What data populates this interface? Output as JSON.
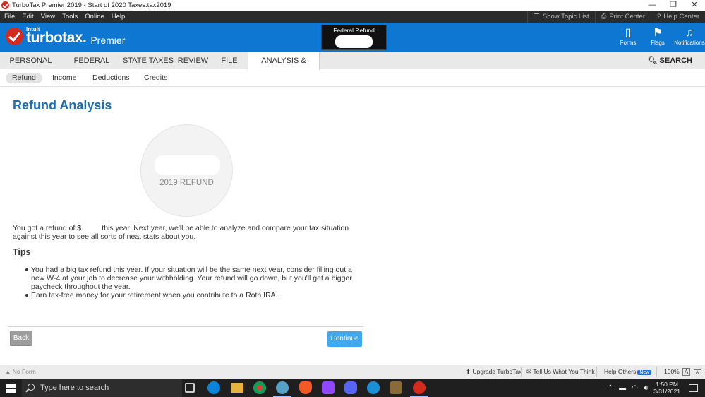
{
  "window": {
    "title": "TurboTax Premier 2019 - Start of 2020 Taxes.tax2019",
    "controls": [
      "—",
      "❐",
      "✕"
    ]
  },
  "menu": {
    "items": [
      "File",
      "Edit",
      "View",
      "Tools",
      "Online",
      "Help"
    ],
    "right": [
      "Show Topic List",
      "Print Center",
      "Help Center"
    ]
  },
  "header": {
    "logo_intuit": "intuit",
    "logo_brand": "turbotax.",
    "logo_edition": "Premier",
    "refund_label": "Federal Refund",
    "icons": [
      {
        "label": "Forms",
        "glyph": "🗋"
      },
      {
        "label": "Flags",
        "glyph": "⚑"
      },
      {
        "label": "Notifications",
        "glyph": "🔔"
      }
    ],
    "brand_color": "#0e77d1"
  },
  "nav": {
    "tabs": [
      "PERSONAL INFO",
      "FEDERAL TAXES",
      "STATE TAXES",
      "REVIEW",
      "FILE",
      "ANALYSIS & ADVICE"
    ],
    "active_tab": "ANALYSIS & ADVICE",
    "search_label": "SEARCH"
  },
  "subtabs": {
    "items": [
      "Refund",
      "Income",
      "Deductions",
      "Credits"
    ],
    "active": "Refund"
  },
  "main": {
    "title": "Refund Analysis",
    "circle_caption": "2019 REFUND",
    "summary": "You got a refund of $          this year. Next year, we'll be able to analyze and compare your tax situation against this year to see all sorts of neat stats about you.",
    "tips_title": "Tips",
    "tips": [
      "You had a big tax refund this year. If your situation will be the same next year, consider filling out a new W-4 at your job to decrease your withholding. Your refund will go down, but you'll get a bigger paycheck throughout the year.",
      "Earn tax-free money for your retirement when you contribute to a Roth IRA."
    ],
    "back_label": "Back",
    "continue_label": "Continue"
  },
  "statusbar": {
    "form": "No Form",
    "upgrade": "Upgrade TurboTax",
    "feedback": "Tell Us What You Think",
    "help_others": "Help Others",
    "new_badge": "New",
    "zoom": "100%",
    "zoom_large": "A",
    "zoom_small": "A"
  },
  "taskbar": {
    "search_placeholder": "Type here to search",
    "time": "1:50 PM",
    "date": "3/31/2021"
  }
}
